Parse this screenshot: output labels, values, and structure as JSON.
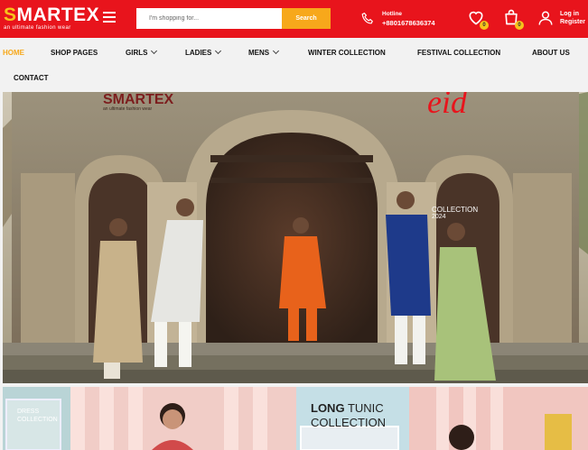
{
  "header": {
    "brand": "SMARTEX",
    "tagline": "an ultimate fashion wear",
    "search_placeholder": "I'm shopping for...",
    "search_button": "Search",
    "hotline_label": "Hotline",
    "hotline_number": "+8801678636374",
    "wishlist_count": "0",
    "cart_count": "0",
    "login_label": "Log in",
    "register_label": "Register",
    "brand_color": "#e8141c",
    "accent_color": "#f7a81b"
  },
  "nav": {
    "items": [
      {
        "label": "HOME",
        "active": true
      },
      {
        "label": "SHOP PAGES"
      },
      {
        "label": "GIRLS",
        "dropdown": true
      },
      {
        "label": "LADIES",
        "dropdown": true
      },
      {
        "label": "MENS",
        "dropdown": true
      },
      {
        "label": "WINTER COLLECTION"
      },
      {
        "label": "FESTIVAL COLLECTION"
      },
      {
        "label": "ABOUT US"
      },
      {
        "label": "CONTACT"
      }
    ]
  },
  "hero": {
    "logo": "SMARTEX",
    "logo_tagline": "an ultimate fashion wear",
    "eid": "eid",
    "collection": "COLLECTION",
    "year": "2024"
  },
  "promo": {
    "left_line1": "DRESS",
    "left_line2": "COLLECTION",
    "long_word": "LONG",
    "tunic_word": "TUNIC",
    "collection_word": "COLLECTION"
  }
}
